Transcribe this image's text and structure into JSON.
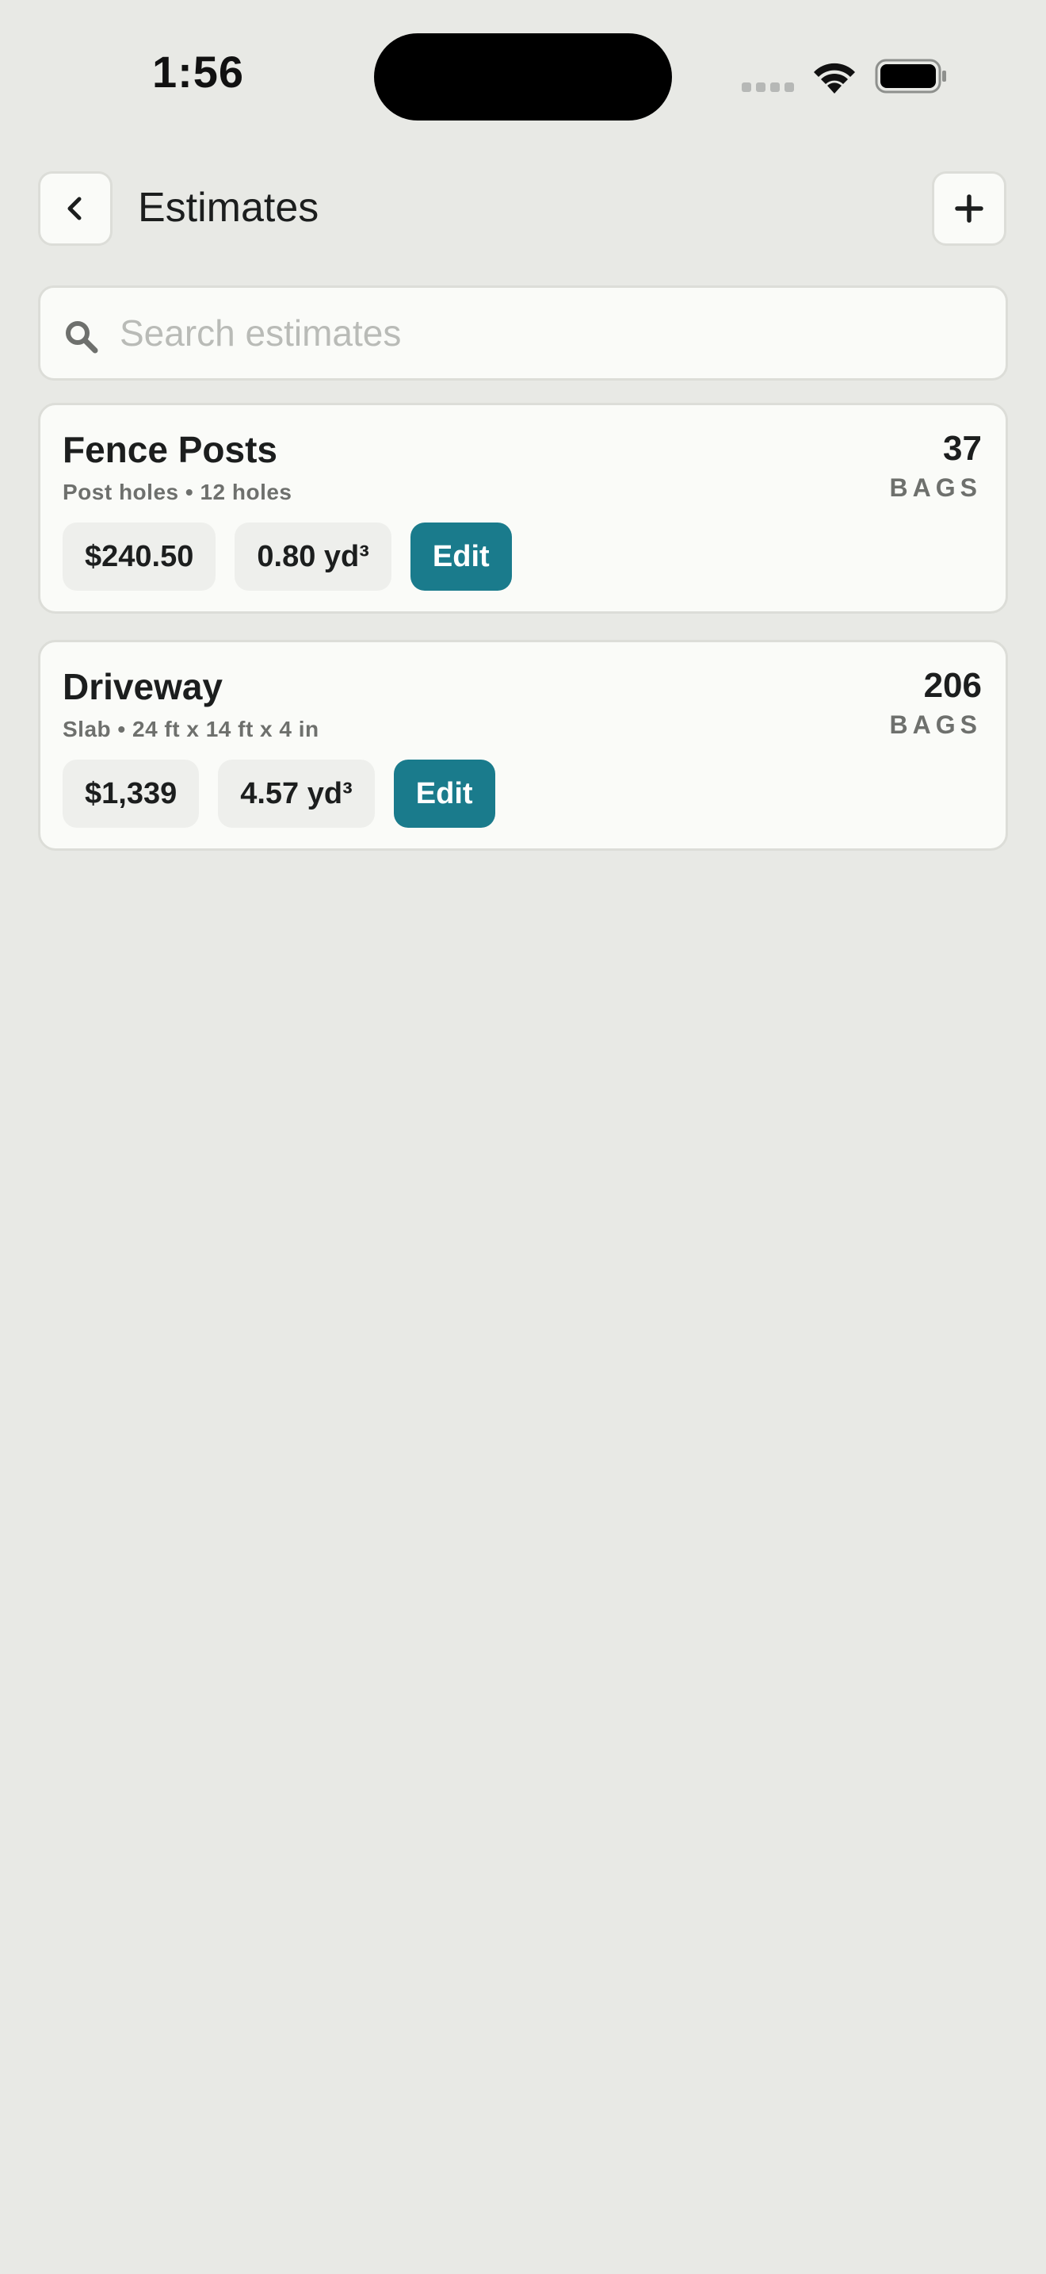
{
  "status_bar": {
    "time": "1:56"
  },
  "header": {
    "title": "Estimates",
    "back_icon": "chevron-left-icon",
    "add_icon": "plus-icon"
  },
  "search": {
    "placeholder": "Search estimates",
    "value": "",
    "icon": "search-icon"
  },
  "estimates": [
    {
      "title": "Fence Posts",
      "subtitle": "Post holes • 12 holes",
      "count": "37",
      "unit": "BAGS",
      "price": "$240.50",
      "volume": "0.80 yd³",
      "edit_label": "Edit"
    },
    {
      "title": "Driveway",
      "subtitle": "Slab • 24 ft x 14 ft x 4 in",
      "count": "206",
      "unit": "BAGS",
      "price": "$1,339",
      "volume": "4.57 yd³",
      "edit_label": "Edit"
    }
  ],
  "colors": {
    "background": "#e8e9e5",
    "card": "#fafbf8",
    "accent": "#1a7b8c",
    "muted_text": "#6e706d"
  }
}
